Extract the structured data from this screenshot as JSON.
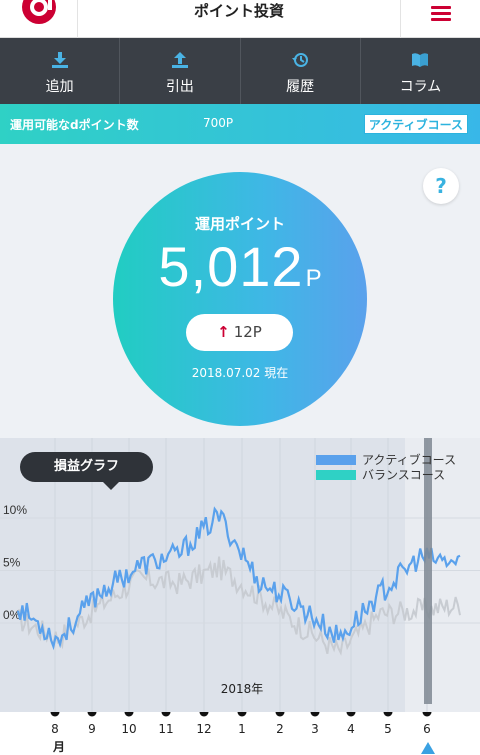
{
  "header": {
    "title": "ポイント投資",
    "logo_icon": "docomo-d-logo",
    "menu_icon": "hamburger-menu-icon"
  },
  "nav": [
    {
      "label": "追加",
      "icon": "download-arrow-icon"
    },
    {
      "label": "引出",
      "icon": "upload-arrow-icon"
    },
    {
      "label": "履歴",
      "icon": "history-icon"
    },
    {
      "label": "コラム",
      "icon": "book-icon"
    }
  ],
  "info": {
    "label": "運用可能なdポイント数",
    "value": "700P",
    "button": "アクティブコース"
  },
  "help": {
    "label": "?"
  },
  "points": {
    "title": "運用ポイント",
    "amount": "5,012",
    "unit": "P",
    "delta_arrow": "↑",
    "delta": "12P",
    "date": "2018.07.02 現在"
  },
  "graph": {
    "badge": "損益グラフ",
    "year_label": "2018年",
    "month_unit": "月"
  },
  "colors": {
    "accent": "#cc0033",
    "active": "#5aa1ec",
    "balance": "#2fd1c5",
    "teal": "#21cdc2"
  },
  "chart_data": {
    "type": "line",
    "x": [
      "8",
      "9",
      "10",
      "11",
      "12",
      "1",
      "2",
      "3",
      "4",
      "5",
      "6"
    ],
    "ylabels": [
      "10%",
      "5%",
      "0%"
    ],
    "yticks": [
      10,
      5,
      0
    ],
    "ylim": [
      -6,
      12
    ],
    "series": [
      {
        "name": "アクティブコース",
        "color": "#5aa1ec",
        "values": [
          0.8,
          -2.4,
          2.1,
          4.6,
          5.8,
          9.5,
          3.2,
          0.9,
          -2.2,
          2.0,
          5.5,
          4.9
        ]
      },
      {
        "name": "バランスコース",
        "color": "#2fd1c5",
        "values": [
          -0.4,
          -2.2,
          0.8,
          3.5,
          3.0,
          4.5,
          1.8,
          -1.0,
          -3.5,
          0.1,
          0.5,
          1.0
        ]
      }
    ],
    "inactive_series_color": "#c8ccd2",
    "highlight_month": "6",
    "grid": true,
    "legend_position": "top-right"
  }
}
